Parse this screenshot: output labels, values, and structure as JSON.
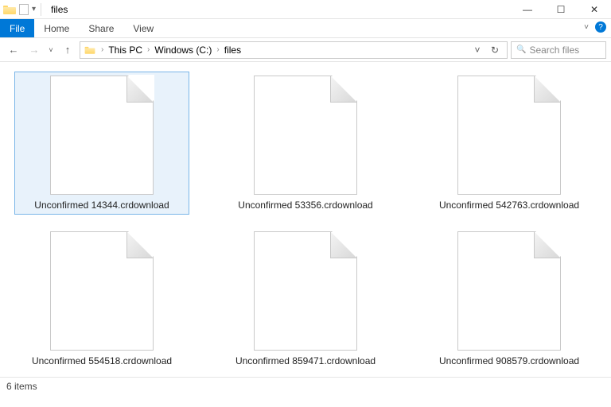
{
  "titlebar": {
    "title": "files",
    "qa_menu_glyph": "▾"
  },
  "wincontrols": {
    "minimize": "—",
    "maximize": "☐",
    "close": "✕"
  },
  "ribbon": {
    "tabs": [
      {
        "label": "File"
      },
      {
        "label": "Home"
      },
      {
        "label": "Share"
      },
      {
        "label": "View"
      }
    ],
    "expand_glyph": "˅",
    "help_glyph": "?"
  },
  "nav": {
    "back": "←",
    "forward": "→",
    "history": "˅",
    "up": "↑",
    "refresh": "↻",
    "dropdown": "˅",
    "breadcrumb": [
      {
        "label": "This PC"
      },
      {
        "label": "Windows (C:)"
      },
      {
        "label": "files"
      }
    ],
    "search_placeholder": "Search files",
    "search_icon": "🔍"
  },
  "files": [
    {
      "name": "Unconfirmed 14344.crdownload",
      "selected": true
    },
    {
      "name": "Unconfirmed 53356.crdownload",
      "selected": false
    },
    {
      "name": "Unconfirmed 542763.crdownload",
      "selected": false
    },
    {
      "name": "Unconfirmed 554518.crdownload",
      "selected": false
    },
    {
      "name": "Unconfirmed 859471.crdownload",
      "selected": false
    },
    {
      "name": "Unconfirmed 908579.crdownload",
      "selected": false
    }
  ],
  "status": {
    "count_label": "6 items"
  }
}
